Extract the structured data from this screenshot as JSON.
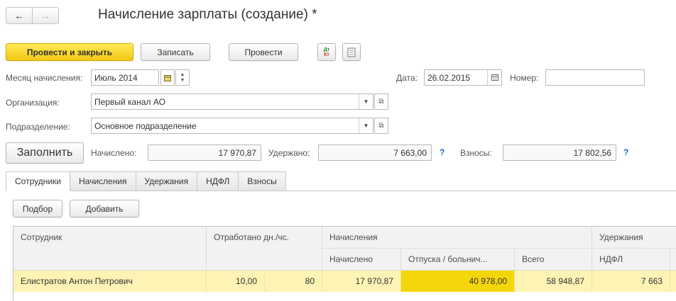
{
  "window": {
    "title": "Начисление зарплаты (создание) *"
  },
  "nav": {
    "back_icon": "←",
    "forward_icon": "→"
  },
  "toolbar": {
    "post_and_close": "Провести и закрыть",
    "save": "Записать",
    "post": "Провести",
    "dt_kt_icon": "ДтКт"
  },
  "header": {
    "month_label": "Месяц начисления:",
    "month_value": "Июль 2014",
    "date_label": "Дата:",
    "date_value": "26.02.2015",
    "number_label": "Номер:",
    "number_value": "",
    "org_label": "Организация:",
    "org_value": "Первый канал АО",
    "dept_label": "Подразделение:",
    "dept_value": "Основное подразделение"
  },
  "totals": {
    "fill_button": "Заполнить",
    "accrued_label": "Начислено:",
    "accrued_value": "17 970,87",
    "withheld_label": "Удержано:",
    "withheld_value": "7 663,00",
    "contrib_label": "Взносы:",
    "contrib_value": "17 802,56",
    "help": "?"
  },
  "tabs": [
    {
      "label": "Сотрудники",
      "active": true
    },
    {
      "label": "Начисления"
    },
    {
      "label": "Удержания"
    },
    {
      "label": "НДФЛ"
    },
    {
      "label": "Взносы"
    }
  ],
  "table_toolbar": {
    "select": "Подбор",
    "add": "Добавить"
  },
  "table": {
    "headers": {
      "employee": "Сотрудник",
      "worked": "Отработано дн./чс.",
      "accruals": "Начисления",
      "accrued": "Начислено",
      "vacation": "Отпуска / больнич...",
      "total": "Всего",
      "deductions": "Удержания",
      "ndfl": "НДФЛ"
    },
    "rows": [
      {
        "employee": "Елистратов Антон Петрович",
        "days": "10,00",
        "hours": "80",
        "accrued": "17 970,87",
        "vacation": "40 978,00",
        "total": "58 948,87",
        "ndfl": "7 663"
      }
    ]
  },
  "colors": {
    "primary_button": "#f5c813",
    "selected_row": "#fcf3b4",
    "highlight_cell": "#f5d60a",
    "help": "#1a6ebf"
  }
}
